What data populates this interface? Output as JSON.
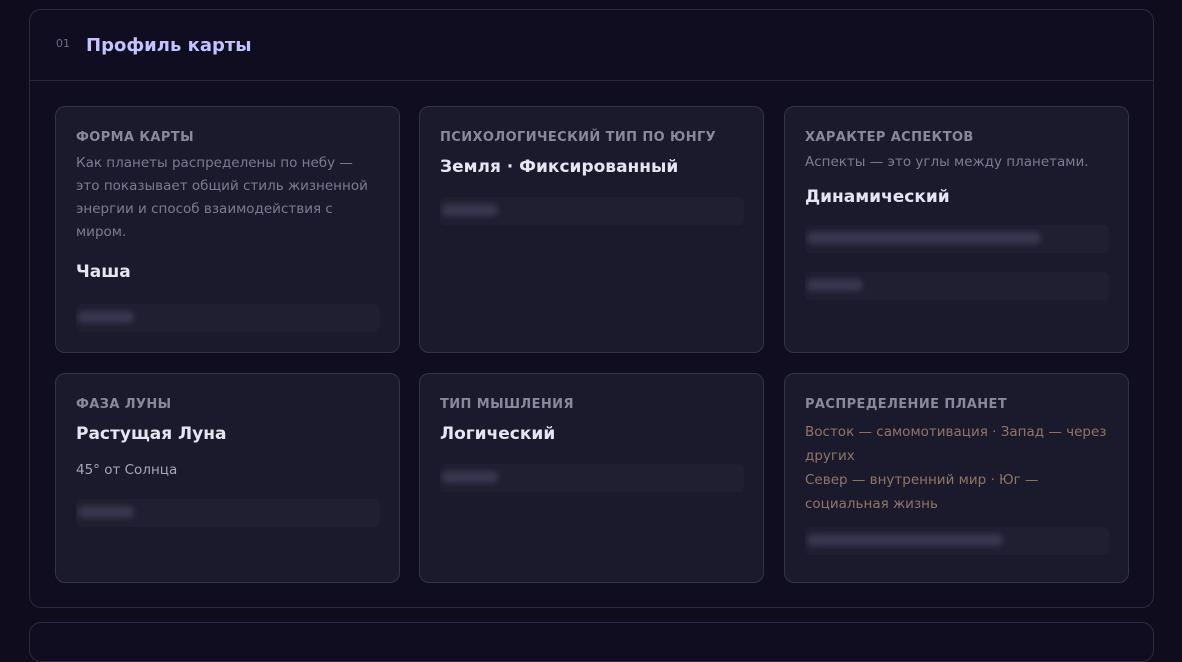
{
  "section": {
    "number": "01",
    "title": "Профиль карты"
  },
  "cards": {
    "chart_shape": {
      "label": "Форма карты",
      "description": "Как планеты распределены по небу — это показывает общий стиль жизненной энергии и способ взаимодействия с миром.",
      "value": "Чаша"
    },
    "jung_type": {
      "label": "Психологический тип по Юнгу",
      "value": "Земля · Фиксированный"
    },
    "aspects": {
      "label": "Характер аспектов",
      "description": "Аспекты — это углы между планетами.",
      "value": "Динамический"
    },
    "moon_phase": {
      "label": "Фаза Луны",
      "value": "Растущая Луна",
      "sub": "45° от Солнца"
    },
    "thinking": {
      "label": "Тип мышления",
      "value": "Логический"
    },
    "distribution": {
      "label": "Распределение планет",
      "line1": "Восток — самомотивация · Запад — через других",
      "line2": "Север — внутренний мир · Юг — социальная жизнь"
    }
  },
  "colors": {
    "background": "#0e0c1d",
    "card": "#1b1a2c",
    "accent_title": "#c4c2ff",
    "distribution_text": "#8f7663"
  }
}
